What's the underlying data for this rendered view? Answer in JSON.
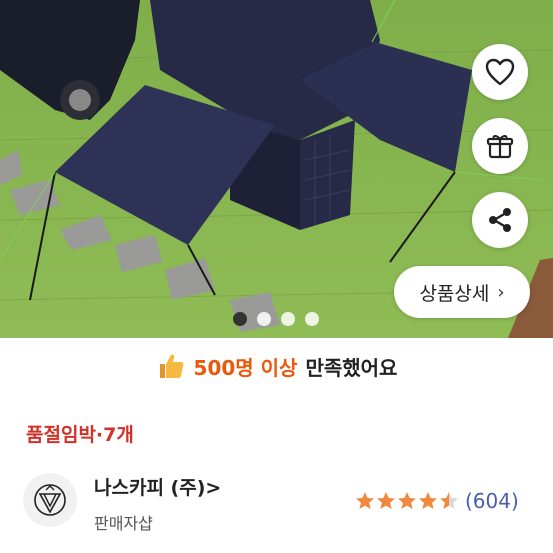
{
  "hero": {
    "carousel_pages": 4,
    "active_page": 1,
    "detail_button": {
      "label": "상품상세",
      "chevron": "›"
    }
  },
  "actions": {
    "like_icon": "heart-icon",
    "gift_icon": "gift-icon",
    "share_icon": "share-icon"
  },
  "satisfaction": {
    "icon": "thumbs-up-icon",
    "highlight": "500명 이상",
    "rest": "만족했어요"
  },
  "stock_notice": "품절임박·7개",
  "seller": {
    "name": "나스카피 (주)",
    "chevron": ">",
    "subtitle": "판매자샵",
    "rating": 4.5,
    "review_count": "(604)"
  },
  "colors": {
    "accent": "#e8590c",
    "warning": "#d33027",
    "star": "#f0883e",
    "review_link": "#4a5fa8"
  }
}
